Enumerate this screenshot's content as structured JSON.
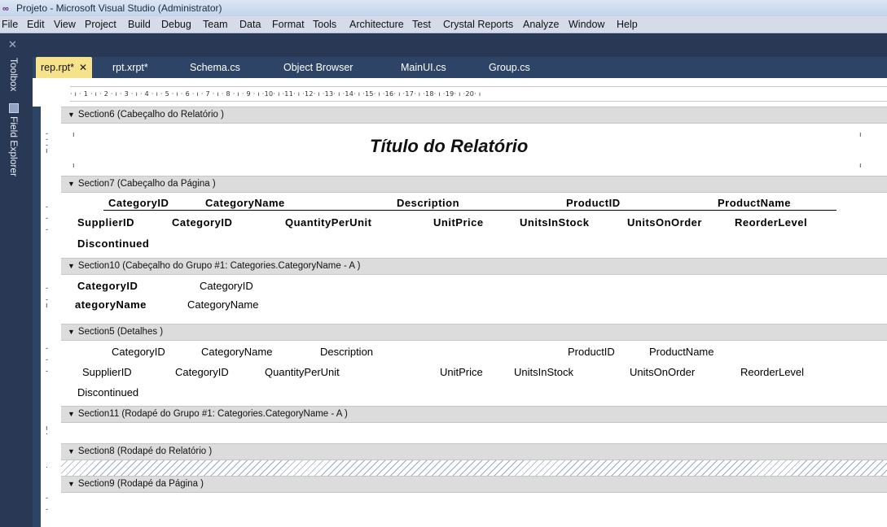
{
  "titlebar": {
    "logo": "∞",
    "title": "Projeto - Microsoft Visual Studio (Administrator)"
  },
  "menu": [
    "File",
    "Edit",
    "View",
    "Project",
    "Build",
    "Debug",
    "Team",
    "Data",
    "Format",
    "Tools",
    "Architecture",
    "Test",
    "Crystal Reports",
    "Analyze",
    "Window",
    "Help"
  ],
  "side_tools": {
    "toolbox": "Toolbox",
    "field_explorer": "Field Explorer"
  },
  "tabs": [
    {
      "label": "rep.rpt*",
      "close": "✕"
    },
    {
      "label": "rpt.xrpt*"
    },
    {
      "label": "Schema.cs"
    },
    {
      "label": "Object Browser"
    },
    {
      "label": "MainUI.cs"
    },
    {
      "label": "Group.cs"
    }
  ],
  "ruler": "· ı · 1 · ı · 2 · ı · 3 · ı · 4 · ı · 5 · ı · 6 · ı · 7 · ı · 8 · ı · 9 · ı ·10· ı ·11· ı ·12· ı ·13· ı ·14· ı ·15· ı ·16· ı ·17· ı ·18· ı ·19· ı ·20· ı",
  "sections": {
    "s6": "Section6 (Cabeçalho do Relatório )",
    "s7": "Section7 (Cabeçalho da Página )",
    "s10": "Section10 (Cabeçalho do Grupo #1: Categories.CategoryName - A )",
    "s5": "Section5 (Detalhes )",
    "s11": "Section11 (Rodapé do Grupo #1: Categories.CategoryName - A )",
    "s8": "Section8 (Rodapé do Relatório )",
    "s9": "Section9 (Rodapé da Página )"
  },
  "report_title": "Título do Relatório",
  "page_header": {
    "row1": [
      "CategoryID",
      "CategoryName",
      "Description",
      "ProductID",
      "ProductName"
    ],
    "row2": [
      "SupplierID",
      "CategoryID",
      "QuantityPerUnit",
      "UnitPrice",
      "UnitsInStock",
      "UnitsOnOrder",
      "ReorderLevel"
    ],
    "row3": [
      "Discontinued"
    ]
  },
  "group_header": {
    "row1": [
      "CategoryID",
      "CategoryID"
    ],
    "row2": [
      "ategoryName",
      "CategoryName"
    ]
  },
  "details": {
    "row1": [
      "CategoryID",
      "CategoryName",
      "Description",
      "ProductID",
      "ProductName"
    ],
    "row2": [
      "SupplierID",
      "CategoryID",
      "QuantityPerUnit",
      "UnitPrice",
      "UnitsInStock",
      "UnitsOnOrder",
      "ReorderLevel"
    ],
    "row3": [
      "Discontinued"
    ]
  }
}
